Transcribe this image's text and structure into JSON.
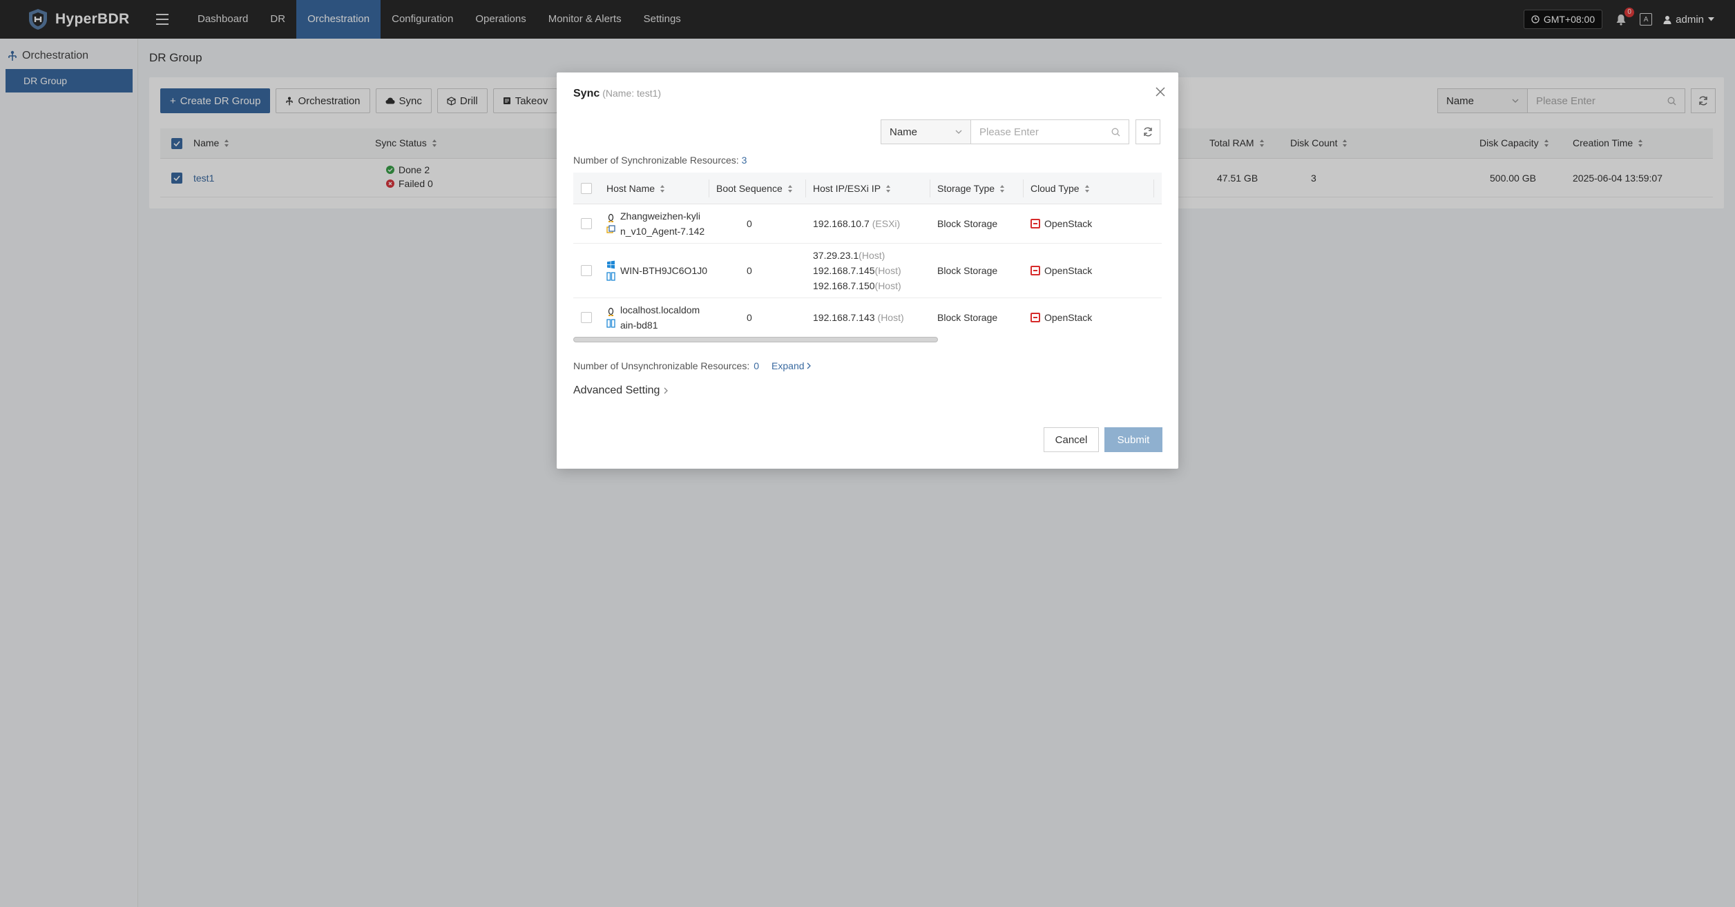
{
  "app": {
    "name": "HyperBDR"
  },
  "nav": {
    "items": [
      {
        "label": "Dashboard"
      },
      {
        "label": "DR"
      },
      {
        "label": "Orchestration"
      },
      {
        "label": "Configuration"
      },
      {
        "label": "Operations"
      },
      {
        "label": "Monitor & Alerts"
      },
      {
        "label": "Settings"
      }
    ],
    "active": "Orchestration",
    "timezone": "GMT+08:00",
    "notification_count": "0",
    "lang_icon": "A",
    "user": "admin"
  },
  "sidebar": {
    "section": "Orchestration",
    "items": [
      {
        "label": "DR Group"
      }
    ]
  },
  "page": {
    "breadcrumb": "DR Group",
    "toolbar": {
      "create": "Create DR Group",
      "orchestration": "Orchestration",
      "sync": "Sync",
      "drill": "Drill",
      "takeover": "Takeov"
    },
    "filter": {
      "field": "Name",
      "placeholder": "Please Enter"
    },
    "table": {
      "headers": {
        "name": "Name",
        "sync_status": "Sync Status",
        "total_ram": "Total RAM",
        "disk_count": "Disk Count",
        "disk_capacity": "Disk Capacity",
        "creation_time": "Creation Time"
      },
      "rows": [
        {
          "name": "test1",
          "sync_done": "Done 2",
          "sync_failed": "Failed 0",
          "total_ram": "47.51 GB",
          "disk_count": "3",
          "disk_capacity": "500.00 GB",
          "creation_time": "2025-06-04 13:59:07"
        }
      ]
    }
  },
  "modal": {
    "title": "Sync",
    "subtitle": "(Name: test1)",
    "filter": {
      "field": "Name",
      "placeholder": "Please Enter"
    },
    "sync_count_label": "Number of Synchronizable Resources:",
    "sync_count": "3",
    "headers": {
      "host_name": "Host Name",
      "boot_sequence": "Boot Sequence",
      "host_ip": "Host IP/ESXi IP",
      "storage_type": "Storage Type",
      "cloud_type": "Cloud Type"
    },
    "rows": [
      {
        "name_line1": "Zhangweizhen-kyli",
        "name_line2": "n_v10_Agent-7.142",
        "boot": "0",
        "ips": [
          {
            "ip": "192.168.10.7",
            "tag": "(ESXi)"
          }
        ],
        "storage": "Block Storage",
        "cloud": "OpenStack"
      },
      {
        "name_line1": "WIN-BTH9JC6O1J0",
        "name_line2": "",
        "boot": "0",
        "ips": [
          {
            "ip": "37.29.23.1",
            "tag": "(Host)"
          },
          {
            "ip": "192.168.7.145",
            "tag": "(Host)"
          },
          {
            "ip": "192.168.7.150",
            "tag": "(Host)"
          }
        ],
        "storage": "Block Storage",
        "cloud": "OpenStack"
      },
      {
        "name_line1": "localhost.localdom",
        "name_line2": "ain-bd81",
        "boot": "0",
        "ips": [
          {
            "ip": "192.168.7.143",
            "tag": "(Host)"
          }
        ],
        "storage": "Block Storage",
        "cloud": "OpenStack"
      }
    ],
    "unsync_label": "Number of Unsynchronizable Resources:",
    "unsync_count": "0",
    "expand": "Expand",
    "advanced": "Advanced Setting",
    "cancel": "Cancel",
    "submit": "Submit"
  },
  "colors": {
    "nav_bg": "#2a2a2a",
    "accent": "#3a6aa0",
    "submit_disabled": "#8fb0cf"
  }
}
